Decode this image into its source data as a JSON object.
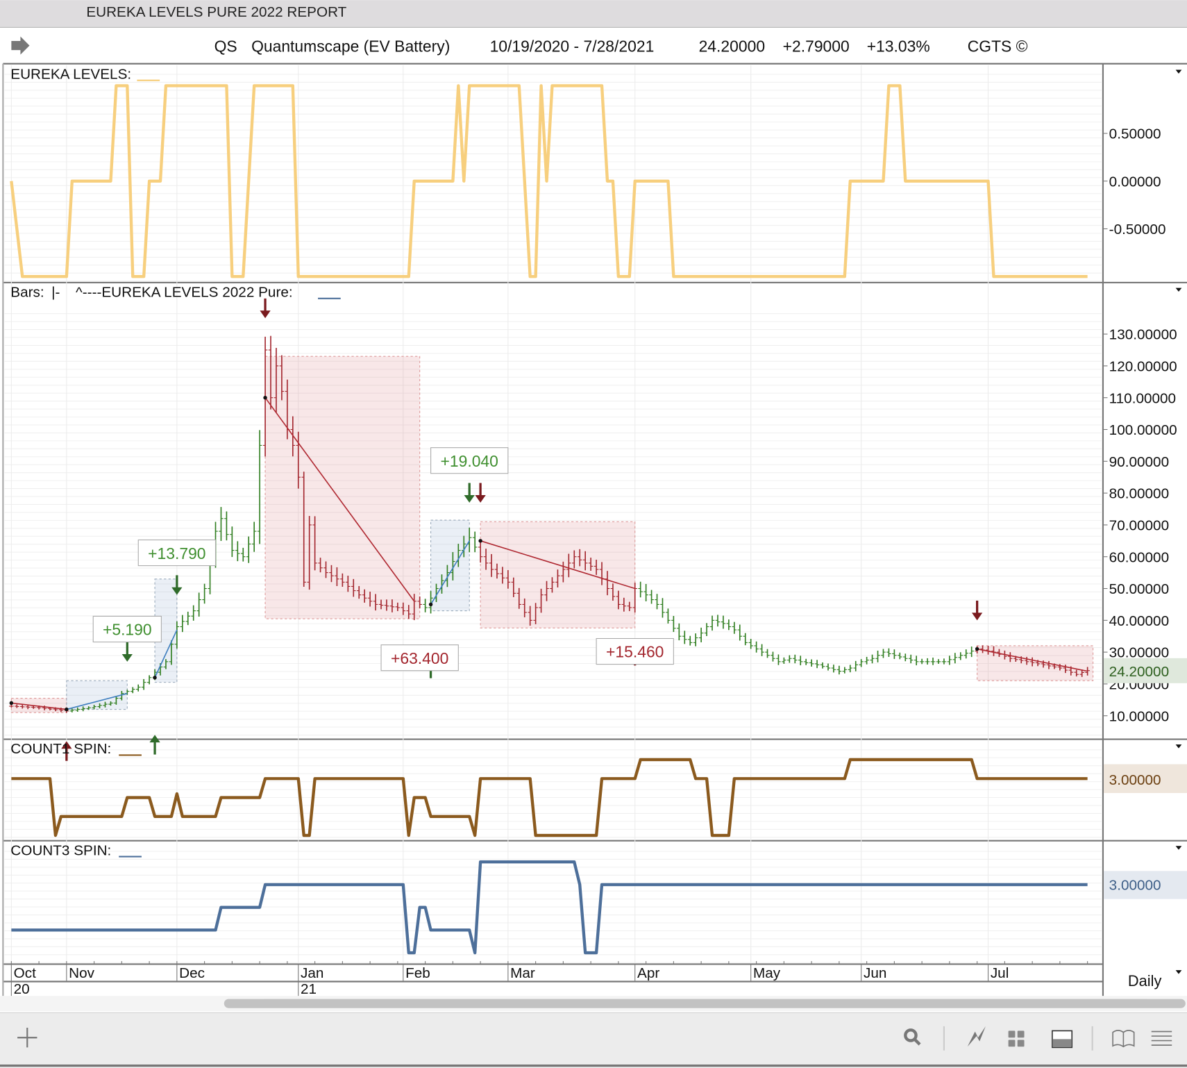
{
  "window": {
    "title": "EUREKA LEVELS PURE 2022 REPORT"
  },
  "header": {
    "symbol": "QS",
    "name": "Quantumscape (EV Battery)",
    "date_range": "10/19/2020 - 7/28/2021",
    "last": "24.20000",
    "change": "+2.79000",
    "change_pct": "+13.03%",
    "copyright": "CGTS ©"
  },
  "panels": {
    "eureka": {
      "label": "EUREKA LEVELS:",
      "color": "#f7cf7e"
    },
    "price": {
      "label_bars": "Bars:",
      "label_study": "^----EUREKA LEVELS  2022  Pure:",
      "last_value": "24.20000"
    },
    "count1": {
      "label": "COUNT1 SPIN:",
      "value": "3.00000",
      "color": "#8b5a1e"
    },
    "count3": {
      "label": "COUNT3 SPIN:",
      "value": "3.00000",
      "color": "#4d6f9a"
    }
  },
  "timeframe": "Daily",
  "chart_data": [
    {
      "type": "line",
      "title": "EUREKA LEVELS",
      "x_unit": "trading day index from 10/19/2020",
      "ylim": [
        -1.1,
        1.1
      ],
      "yticks": [
        "0.50000",
        "0.00000",
        "-0.50000"
      ],
      "ytick_values": [
        0.5,
        0,
        -0.5
      ],
      "points": [
        [
          0,
          0
        ],
        [
          2,
          -1
        ],
        [
          10,
          -1
        ],
        [
          11,
          0
        ],
        [
          18,
          0
        ],
        [
          19,
          1
        ],
        [
          21,
          1
        ],
        [
          22,
          -1
        ],
        [
          24,
          -1
        ],
        [
          25,
          0
        ],
        [
          27,
          0
        ],
        [
          28,
          1
        ],
        [
          39,
          1
        ],
        [
          40,
          -1
        ],
        [
          42,
          -1
        ],
        [
          44,
          1
        ],
        [
          51,
          1
        ],
        [
          52,
          -1
        ],
        [
          72,
          -1
        ],
        [
          73,
          0
        ],
        [
          80,
          0
        ],
        [
          81,
          1
        ],
        [
          82,
          0
        ],
        [
          83,
          1
        ],
        [
          92,
          1
        ],
        [
          94,
          -1
        ],
        [
          95,
          -1
        ],
        [
          96,
          1
        ],
        [
          97,
          0
        ],
        [
          98,
          1
        ],
        [
          107,
          1
        ],
        [
          108,
          0
        ],
        [
          109,
          0
        ],
        [
          110,
          -1
        ],
        [
          112,
          -1
        ],
        [
          113,
          0
        ],
        [
          119,
          0
        ],
        [
          120,
          -1
        ],
        [
          151,
          -1
        ],
        [
          152,
          0
        ],
        [
          158,
          0
        ],
        [
          159,
          1
        ],
        [
          161,
          1
        ],
        [
          162,
          0
        ],
        [
          177,
          0
        ],
        [
          178,
          -1
        ],
        [
          195,
          -1
        ]
      ]
    },
    {
      "type": "bar-ohlc",
      "title": "QS daily bars",
      "ylim": [
        5,
        140
      ],
      "yticks": [
        "10.00000",
        "20.00000",
        "30.00000",
        "40.00000",
        "50.00000",
        "60.00000",
        "70.00000",
        "80.00000",
        "90.00000",
        "100.00000",
        "110.00000",
        "120.00000",
        "130.00000"
      ],
      "ytick_values": [
        10,
        20,
        30,
        40,
        50,
        60,
        70,
        80,
        90,
        100,
        110,
        120,
        130
      ],
      "close_path": [
        [
          0,
          13
        ],
        [
          5,
          12.5
        ],
        [
          10,
          11.5
        ],
        [
          14,
          12.5
        ],
        [
          18,
          14
        ],
        [
          20,
          17
        ],
        [
          23,
          19
        ],
        [
          25,
          22
        ],
        [
          28,
          27
        ],
        [
          30,
          38
        ],
        [
          33,
          43
        ],
        [
          35,
          50
        ],
        [
          37,
          68
        ],
        [
          38,
          72
        ],
        [
          40,
          62
        ],
        [
          42,
          60
        ],
        [
          44,
          68
        ],
        [
          45,
          95
        ],
        [
          46,
          125
        ],
        [
          47,
          110
        ],
        [
          48,
          120
        ],
        [
          49,
          112
        ],
        [
          50,
          100
        ],
        [
          51,
          95
        ],
        [
          52,
          85
        ],
        [
          53,
          52
        ],
        [
          54,
          70
        ],
        [
          55,
          58
        ],
        [
          57,
          55
        ],
        [
          60,
          52
        ],
        [
          63,
          48
        ],
        [
          66,
          45
        ],
        [
          70,
          44
        ],
        [
          72,
          42
        ],
        [
          73,
          46
        ],
        [
          75,
          44
        ],
        [
          77,
          50
        ],
        [
          79,
          55
        ],
        [
          81,
          62
        ],
        [
          83,
          66
        ],
        [
          85,
          60
        ],
        [
          87,
          56
        ],
        [
          90,
          52
        ],
        [
          92,
          45
        ],
        [
          94,
          40
        ],
        [
          96,
          48
        ],
        [
          98,
          52
        ],
        [
          100,
          56
        ],
        [
          102,
          60
        ],
        [
          104,
          58
        ],
        [
          106,
          56
        ],
        [
          108,
          50
        ],
        [
          110,
          45
        ],
        [
          112,
          44
        ],
        [
          113,
          50
        ],
        [
          115,
          48
        ],
        [
          117,
          45
        ],
        [
          119,
          40
        ],
        [
          121,
          35
        ],
        [
          123,
          33
        ],
        [
          125,
          36
        ],
        [
          127,
          40
        ],
        [
          129,
          39
        ],
        [
          131,
          37
        ],
        [
          133,
          33
        ],
        [
          136,
          30
        ],
        [
          139,
          27
        ],
        [
          141,
          28
        ],
        [
          143,
          27
        ],
        [
          146,
          26
        ],
        [
          148,
          25
        ],
        [
          150,
          24
        ],
        [
          152,
          25
        ],
        [
          154,
          27
        ],
        [
          156,
          28
        ],
        [
          158,
          30
        ],
        [
          160,
          29
        ],
        [
          162,
          28
        ],
        [
          164,
          27
        ],
        [
          166,
          27
        ],
        [
          169,
          27
        ],
        [
          172,
          29
        ],
        [
          175,
          31
        ],
        [
          178,
          30
        ],
        [
          181,
          28
        ],
        [
          184,
          27
        ],
        [
          187,
          26
        ],
        [
          190,
          25
        ],
        [
          193,
          23
        ],
        [
          195,
          24.2
        ]
      ],
      "months": [
        {
          "label": "Oct",
          "sub": "20",
          "day": 0
        },
        {
          "label": "Nov",
          "day": 10
        },
        {
          "label": "Dec",
          "day": 30
        },
        {
          "label": "Jan",
          "sub": "21",
          "day": 52
        },
        {
          "label": "Feb",
          "day": 71
        },
        {
          "label": "Mar",
          "day": 90
        },
        {
          "label": "Apr",
          "day": 113
        },
        {
          "label": "May",
          "day": 134
        },
        {
          "label": "Jun",
          "day": 154
        },
        {
          "label": "Jul",
          "day": 177
        }
      ],
      "red_boxes": [
        [
          0,
          10,
          11,
          15.5
        ],
        [
          46,
          74,
          40.5,
          123
        ],
        [
          85,
          113,
          37.6,
          71
        ],
        [
          175,
          196,
          21,
          32
        ]
      ],
      "blue_boxes": [
        [
          10,
          21,
          12,
          21
        ],
        [
          26,
          30,
          20.5,
          53
        ],
        [
          76,
          83,
          43,
          71.5
        ]
      ],
      "trend_lines": [
        {
          "color": "red",
          "from": [
            0,
            14
          ],
          "to": [
            10,
            12
          ]
        },
        {
          "color": "blue",
          "from": [
            10,
            12
          ],
          "to": [
            21,
            17
          ]
        },
        {
          "color": "blue",
          "from": [
            26,
            22
          ],
          "to": [
            30,
            37
          ]
        },
        {
          "color": "red",
          "from": [
            46,
            110
          ],
          "to": [
            73,
            46
          ]
        },
        {
          "color": "blue",
          "from": [
            76,
            45
          ],
          "to": [
            83,
            65
          ]
        },
        {
          "color": "red",
          "from": [
            85,
            65
          ],
          "to": [
            113,
            50
          ]
        },
        {
          "color": "red",
          "from": [
            175,
            31
          ],
          "to": [
            195,
            24
          ]
        }
      ],
      "labels": [
        {
          "text": "+5.190",
          "color": "green",
          "day": 21,
          "price": 37
        },
        {
          "text": "+13.790",
          "color": "green",
          "day": 30,
          "price": 61
        },
        {
          "text": "+63.400",
          "color": "red",
          "day": 74,
          "price": 28
        },
        {
          "text": "+19.040",
          "color": "green",
          "day": 83,
          "price": 90
        },
        {
          "text": "+15.460",
          "color": "red",
          "day": 113,
          "price": 30
        }
      ],
      "arrows": [
        {
          "dir": "up",
          "color": "red",
          "day": 10,
          "price": 2
        },
        {
          "dir": "down",
          "color": "green",
          "day": 21,
          "price": 27
        },
        {
          "dir": "up",
          "color": "green",
          "day": 26,
          "price": 4
        },
        {
          "dir": "down",
          "color": "green",
          "day": 30,
          "price": 48
        },
        {
          "dir": "down",
          "color": "red",
          "day": 46,
          "price": 135
        },
        {
          "dir": "up",
          "color": "red",
          "day": 74,
          "price": 32
        },
        {
          "dir": "up",
          "color": "green",
          "day": 76,
          "price": 28
        },
        {
          "dir": "down",
          "color": "green",
          "day": 83,
          "price": 77
        },
        {
          "dir": "down",
          "color": "red",
          "day": 85,
          "price": 77
        },
        {
          "dir": "up",
          "color": "red",
          "day": 113,
          "price": 32
        },
        {
          "dir": "down",
          "color": "red",
          "day": 175,
          "price": 40
        }
      ]
    },
    {
      "type": "line",
      "title": "COUNT1 SPIN",
      "ylim": [
        0,
        4
      ],
      "yticks": [
        "3.00000"
      ],
      "points": [
        [
          0,
          3
        ],
        [
          7,
          3
        ],
        [
          8,
          0
        ],
        [
          9,
          1
        ],
        [
          20,
          1
        ],
        [
          21,
          2
        ],
        [
          25,
          2
        ],
        [
          26,
          1
        ],
        [
          29,
          1
        ],
        [
          30,
          2.2
        ],
        [
          31,
          1
        ],
        [
          37,
          1
        ],
        [
          38,
          2
        ],
        [
          45,
          2
        ],
        [
          46,
          3
        ],
        [
          52,
          3
        ],
        [
          53,
          0
        ],
        [
          54,
          0
        ],
        [
          55,
          3
        ],
        [
          71,
          3
        ],
        [
          72,
          0
        ],
        [
          73,
          2
        ],
        [
          75,
          2
        ],
        [
          76,
          1
        ],
        [
          83,
          1
        ],
        [
          84,
          0
        ],
        [
          85,
          3
        ],
        [
          94,
          3
        ],
        [
          95,
          0
        ],
        [
          106,
          0
        ],
        [
          107,
          3
        ],
        [
          113,
          3
        ],
        [
          114,
          4
        ],
        [
          123,
          4
        ],
        [
          124,
          3
        ],
        [
          126,
          3
        ],
        [
          127,
          0
        ],
        [
          130,
          0
        ],
        [
          131,
          3
        ],
        [
          151,
          3
        ],
        [
          152,
          4
        ],
        [
          174,
          4
        ],
        [
          175,
          3
        ],
        [
          195,
          3
        ]
      ]
    },
    {
      "type": "line",
      "title": "COUNT3 SPIN",
      "ylim": [
        0,
        4
      ],
      "yticks": [
        "3.00000"
      ],
      "points": [
        [
          0,
          1
        ],
        [
          37,
          1
        ],
        [
          38,
          2
        ],
        [
          45,
          2
        ],
        [
          46,
          3
        ],
        [
          71,
          3
        ],
        [
          72,
          0
        ],
        [
          73,
          0
        ],
        [
          74,
          2
        ],
        [
          75,
          2
        ],
        [
          76,
          1
        ],
        [
          83,
          1
        ],
        [
          84,
          0
        ],
        [
          85,
          4
        ],
        [
          102,
          4
        ],
        [
          103,
          3
        ],
        [
          104,
          0
        ],
        [
          106,
          0
        ],
        [
          107,
          3
        ],
        [
          195,
          3
        ]
      ]
    }
  ]
}
